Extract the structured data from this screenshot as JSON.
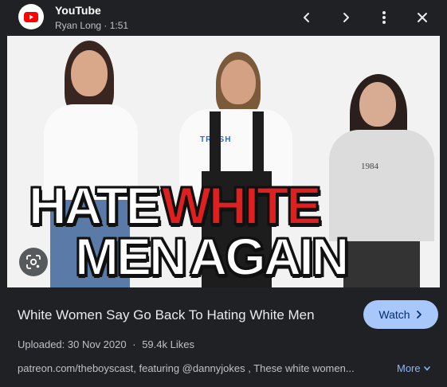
{
  "source": {
    "name": "YouTube",
    "channel": "Ryan Long",
    "separator": "·",
    "duration": "1:51"
  },
  "icons": {
    "logo": "youtube-logo-icon",
    "prev": "chevron-left-icon",
    "next": "chevron-right-icon",
    "menu": "more-vert-icon",
    "close": "close-icon",
    "lens": "lens-icon",
    "watch": "chevron-right-icon",
    "more": "chevron-down-icon"
  },
  "thumbnail": {
    "line1_a": "HATE",
    "line1_b": "WHITE",
    "line2_a": "MEN",
    "line2_b": "AGAIN",
    "shirt_text": "TRASH",
    "sweatshirt_text": "1984"
  },
  "video": {
    "title": "White Women Say Go Back To Hating White Men",
    "watch_label": "Watch",
    "uploaded": "Uploaded: 30 Nov 2020",
    "dot": "·",
    "likes": "59.4k Likes",
    "description": "patreon.com/theboyscast, featuring @dannyjokes , These white women...",
    "more_label": "More"
  },
  "colors": {
    "background": "#202124",
    "accent": "#a8c7fa",
    "link": "#8ab4f8",
    "overlay_red": "#e02020",
    "youtube_red": "#ff0000"
  }
}
